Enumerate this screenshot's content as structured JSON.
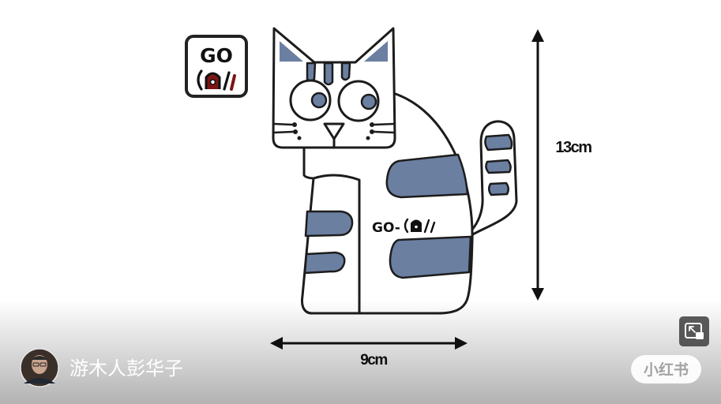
{
  "app": {
    "name": "小红书"
  },
  "video": {
    "logo_text": "GO",
    "body_label": "GO-",
    "height_label": "13cm",
    "width_label": "9cm"
  },
  "author": {
    "username": "游木人彭华子"
  },
  "controls": {
    "pip_icon": "picture-in-picture-icon"
  },
  "colors": {
    "stripe": "#6b7fa1",
    "outline": "#1c1c1c",
    "logo_red": "#7c1515"
  }
}
